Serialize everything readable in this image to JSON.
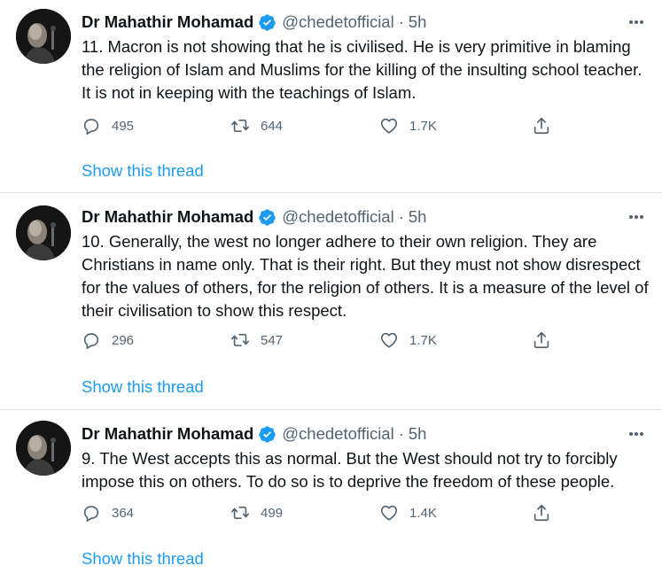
{
  "author": {
    "name": "Dr Mahathir Mohamad",
    "handle": "@chedetofficial",
    "separator": "·",
    "verified_icon": "verified-badge-icon"
  },
  "show_thread_label": "Show this thread",
  "colors": {
    "link": "#1d9bf0",
    "muted": "#536471",
    "verified": "#1d9bf0",
    "divider": "#e1e8ed"
  },
  "tweets": [
    {
      "time": "5h",
      "text": "11. Macron is not showing that he is civilised. He is very primitive in blaming the religion of Islam and Muslims for the killing of the insulting school teacher. It is not in keeping with the teachings of Islam.",
      "replies": "495",
      "retweets": "644",
      "likes": "1.7K"
    },
    {
      "time": "5h",
      "text": "10. Generally, the west no longer adhere to their own religion. They are Christians in name only. That is their right. But they must not show disrespect for the values of others, for the religion of others. It is a measure of the level of their civilisation to show this respect.",
      "replies": "296",
      "retweets": "547",
      "likes": "1.7K"
    },
    {
      "time": "5h",
      "text": "9. The West accepts this as normal. But the West should not try to forcibly impose this on others. To do so is to deprive the freedom of these people.",
      "replies": "364",
      "retweets": "499",
      "likes": "1.4K"
    }
  ]
}
